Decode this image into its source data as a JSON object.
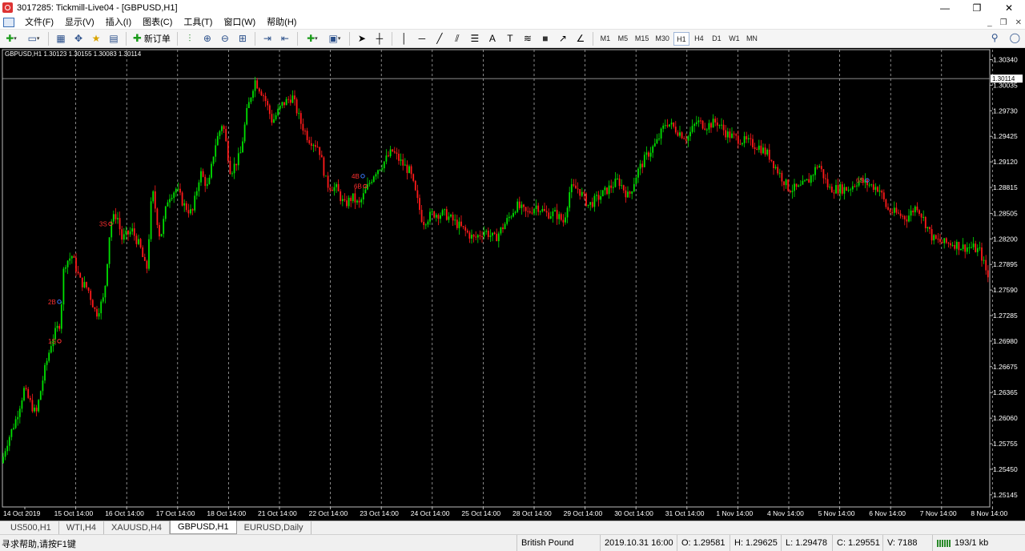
{
  "window": {
    "title": "3017285: Tickmill-Live04 - [GBPUSD,H1]",
    "controls": [
      "—",
      "❐",
      "✕"
    ]
  },
  "menu": {
    "items": [
      "文件(F)",
      "显示(V)",
      "插入(I)",
      "图表(C)",
      "工具(T)",
      "窗口(W)",
      "帮助(H)"
    ],
    "mdi_controls": [
      "_",
      "❐",
      "✕"
    ]
  },
  "toolbar": {
    "new_order_label": "新订单",
    "timeframes": [
      "M1",
      "M5",
      "M15",
      "M30",
      "H1",
      "H4",
      "D1",
      "W1",
      "MN"
    ],
    "active_timeframe": "H1"
  },
  "chart": {
    "info": "GBPUSD,H1  1.30123 1.30155 1.30083 1.30114",
    "current_price_label": "1.30114",
    "markers": [
      {
        "label": "1S",
        "color": "#ff3030"
      },
      {
        "label": "2B",
        "color": "#ff3030"
      },
      {
        "label": "3S",
        "color": "#ff3030"
      },
      {
        "label": "4B",
        "color": "#ff3030"
      },
      {
        "label": "6B",
        "color": "#ff3030"
      },
      {
        "label": "6S",
        "color": "#ff3030"
      }
    ],
    "colors": {
      "background": "#000000",
      "bull": "#00e000",
      "bear": "#ff1a1a",
      "grid": "#c0c0c0",
      "axis_text": "#ffffff"
    }
  },
  "chart_data": {
    "type": "candlestick",
    "symbol": "GBPUSD",
    "timeframe": "H1",
    "ohlc_last": {
      "open": 1.30123,
      "high": 1.30155,
      "low": 1.30083,
      "close": 1.30114
    },
    "y_ticks": [
      "1.30340",
      "1.30035",
      "1.29730",
      "1.29425",
      "1.29120",
      "1.28815",
      "1.28505",
      "1.28200",
      "1.27895",
      "1.27590",
      "1.27285",
      "1.26980",
      "1.26675",
      "1.26365",
      "1.26060",
      "1.25755",
      "1.25450",
      "1.25145"
    ],
    "ylim": [
      1.25,
      1.3045
    ],
    "x_ticks": [
      "14 Oct 2019",
      "15 Oct 14:00",
      "16 Oct 14:00",
      "17 Oct 14:00",
      "18 Oct 14:00",
      "21 Oct 14:00",
      "22 Oct 14:00",
      "23 Oct 14:00",
      "24 Oct 14:00",
      "25 Oct 14:00",
      "28 Oct 14:00",
      "29 Oct 14:00",
      "30 Oct 14:00",
      "31 Oct 14:00",
      "1 Nov 14:00",
      "4 Nov 14:00",
      "5 Nov 14:00",
      "6 Nov 14:00",
      "7 Nov 14:00",
      "8 Nov 14:00"
    ],
    "path_anchors": [
      [
        0,
        1.2545
      ],
      [
        8,
        1.2575
      ],
      [
        20,
        1.2605
      ],
      [
        30,
        1.264
      ],
      [
        45,
        1.261
      ],
      [
        55,
        1.266
      ],
      [
        65,
        1.27
      ],
      [
        75,
        1.272
      ],
      [
        80,
        1.279
      ],
      [
        90,
        1.28
      ],
      [
        100,
        1.277
      ],
      [
        110,
        1.276
      ],
      [
        120,
        1.273
      ],
      [
        130,
        1.275
      ],
      [
        138,
        1.284
      ],
      [
        146,
        1.285
      ],
      [
        152,
        1.282
      ],
      [
        165,
        1.283
      ],
      [
        175,
        1.281
      ],
      [
        183,
        1.278
      ],
      [
        190,
        1.288
      ],
      [
        200,
        1.282
      ],
      [
        210,
        1.287
      ],
      [
        220,
        1.288
      ],
      [
        230,
        1.286
      ],
      [
        240,
        1.285
      ],
      [
        250,
        1.29
      ],
      [
        260,
        1.288
      ],
      [
        268,
        1.293
      ],
      [
        278,
        1.296
      ],
      [
        288,
        1.29
      ],
      [
        300,
        1.292
      ],
      [
        308,
        1.297
      ],
      [
        318,
        1.301
      ],
      [
        330,
        1.299
      ],
      [
        340,
        1.296
      ],
      [
        352,
        1.298
      ],
      [
        365,
        1.299
      ],
      [
        375,
        1.296
      ],
      [
        385,
        1.294
      ],
      [
        398,
        1.293
      ],
      [
        408,
        1.2885
      ],
      [
        420,
        1.288
      ],
      [
        430,
        1.286
      ],
      [
        440,
        1.287
      ],
      [
        448,
        1.286
      ],
      [
        458,
        1.288
      ],
      [
        468,
        1.29
      ],
      [
        478,
        1.291
      ],
      [
        490,
        1.2925
      ],
      [
        502,
        1.291
      ],
      [
        512,
        1.29
      ],
      [
        520,
        1.287
      ],
      [
        528,
        1.284
      ],
      [
        540,
        1.285
      ],
      [
        555,
        1.285
      ],
      [
        568,
        1.284
      ],
      [
        580,
        1.283
      ],
      [
        592,
        1.282
      ],
      [
        605,
        1.283
      ],
      [
        618,
        1.282
      ],
      [
        632,
        1.284
      ],
      [
        645,
        1.286
      ],
      [
        658,
        1.285
      ],
      [
        670,
        1.286
      ],
      [
        682,
        1.285
      ],
      [
        694,
        1.285
      ],
      [
        704,
        1.284
      ],
      [
        712,
        1.288
      ],
      [
        722,
        1.288
      ],
      [
        735,
        1.286
      ],
      [
        748,
        1.287
      ],
      [
        760,
        1.288
      ],
      [
        772,
        1.289
      ],
      [
        785,
        1.287
      ],
      [
        796,
        1.29
      ],
      [
        808,
        1.292
      ],
      [
        820,
        1.2935
      ],
      [
        832,
        1.296
      ],
      [
        845,
        1.295
      ],
      [
        858,
        1.294
      ],
      [
        870,
        1.296
      ],
      [
        882,
        1.2955
      ],
      [
        895,
        1.296
      ],
      [
        908,
        1.2945
      ],
      [
        920,
        1.294
      ],
      [
        935,
        1.2935
      ],
      [
        948,
        1.293
      ],
      [
        960,
        1.292
      ],
      [
        972,
        1.29
      ],
      [
        985,
        1.288
      ],
      [
        998,
        1.288
      ],
      [
        1010,
        1.289
      ],
      [
        1022,
        1.291
      ],
      [
        1035,
        1.288
      ],
      [
        1048,
        1.288
      ],
      [
        1060,
        1.288
      ],
      [
        1072,
        1.289
      ],
      [
        1085,
        1.2885
      ],
      [
        1098,
        1.288
      ],
      [
        1108,
        1.2855
      ],
      [
        1120,
        1.285
      ],
      [
        1132,
        1.2845
      ],
      [
        1145,
        1.286
      ],
      [
        1155,
        1.284
      ],
      [
        1165,
        1.282
      ],
      [
        1178,
        1.2815
      ],
      [
        1190,
        1.2815
      ],
      [
        1202,
        1.281
      ],
      [
        1214,
        1.281
      ],
      [
        1224,
        1.2805
      ],
      [
        1235,
        1.277
      ]
    ]
  },
  "tabs": [
    "US500,H1",
    "WTI,H4",
    "XAUUSD,H4",
    "GBPUSD,H1",
    "EURUSD,Daily"
  ],
  "active_tab": "GBPUSD,H1",
  "status": {
    "help": "寻求帮助,请按F1键",
    "symbol_name": "British Pound",
    "datetime": "2019.10.31 16:00",
    "open": "O: 1.29581",
    "high": "H: 1.29625",
    "low": "L: 1.29478",
    "close": "C: 1.29551",
    "volume": "V: 7188",
    "traffic": "193/1 kb"
  }
}
